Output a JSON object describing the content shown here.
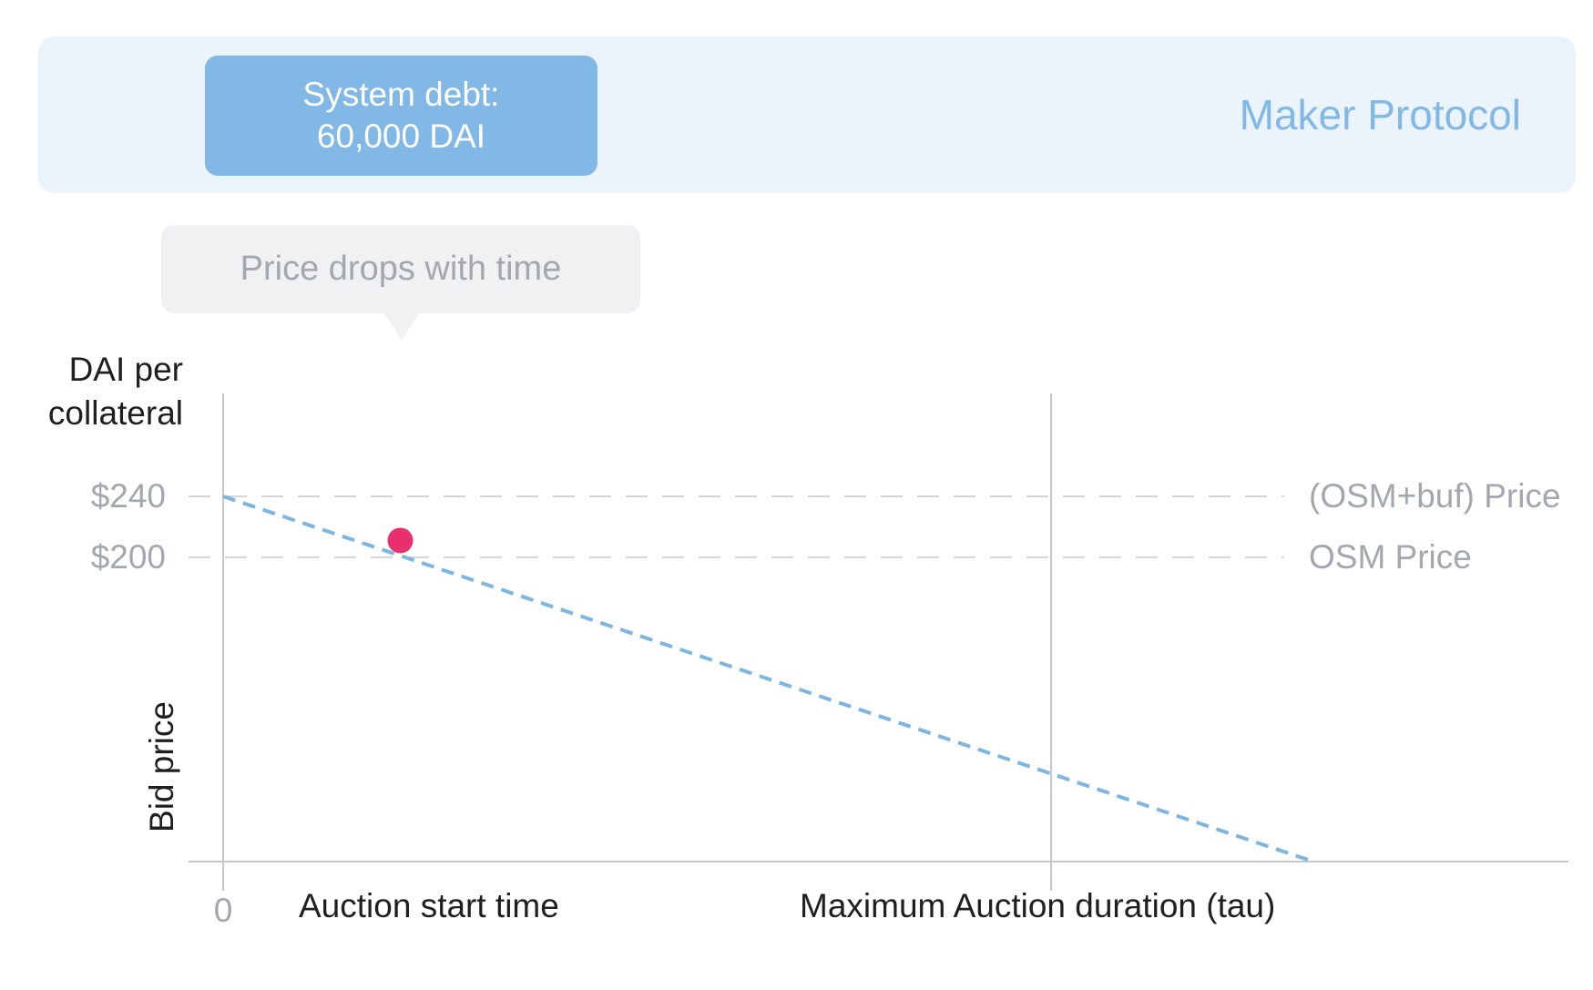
{
  "banner": {
    "debt_line1": "System debt:",
    "debt_line2": "60,000 DAI",
    "title": "Maker Protocol"
  },
  "callout": {
    "text": "Price drops with time"
  },
  "chart_data": {
    "type": "line",
    "title": "",
    "ylabel": "Bid price",
    "y_unit_line1": "DAI per",
    "y_unit_line2": "collateral",
    "y_ticks": [
      {
        "value": 240,
        "label": "$240"
      },
      {
        "value": 200,
        "label": "$200"
      }
    ],
    "ylim": [
      0,
      240
    ],
    "x_origin_label": "0",
    "x_labels": {
      "start": "Auction start time",
      "max_duration": "Maximum Auction duration (tau)"
    },
    "reference_lines": [
      {
        "value": 240,
        "label": "(OSM+buf) Price"
      },
      {
        "value": 200,
        "label": "OSM Price"
      }
    ],
    "series": [
      {
        "x": [
          0,
          1.317
        ],
        "y": [
          240,
          0
        ]
      }
    ],
    "current_point": {
      "x": 0.214,
      "y": 211
    },
    "max_duration_x": 1,
    "colors": {
      "price_line": "#7db5e3",
      "current_point": "#e8306f",
      "reference_line": "#d3d5d8",
      "axis": "#c4c7cb"
    }
  }
}
